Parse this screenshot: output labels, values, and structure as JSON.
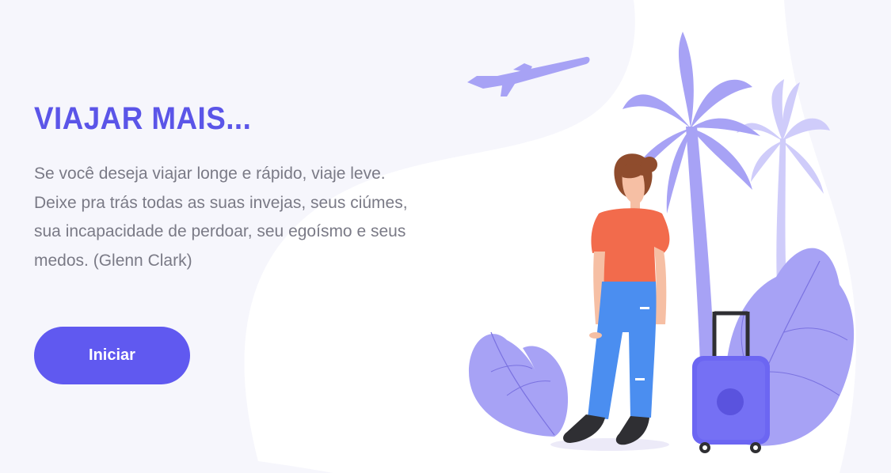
{
  "hero": {
    "title": "VIAJAR MAIS...",
    "quote": "Se você deseja viajar longe e rápido, viaje leve. Deixe pra trás todas as suas invejas, seus ciúmes, sua incapacidade de perdoar, seu egoísmo e seus medos. (Glenn Clark)",
    "button_label": "Iniciar"
  },
  "illustration": {
    "icons": [
      "airplane-icon",
      "palm-tree-icon",
      "traveler-woman",
      "suitcase-icon",
      "leaf-plant-icon"
    ]
  },
  "colors": {
    "accent": "#6059f0",
    "title": "#5b55e8",
    "text": "#7a7a86",
    "illustration_purple": "#a7a2f5",
    "illustration_light": "#cfccfa",
    "shirt": "#f26b4c",
    "jeans": "#4b8ef0",
    "background_wave": "#f6f6fc"
  }
}
